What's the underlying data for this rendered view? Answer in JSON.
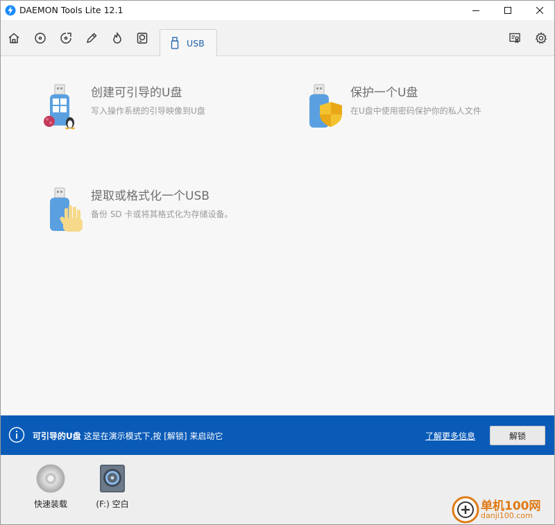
{
  "window": {
    "title": "DAEMON Tools Lite 12.1"
  },
  "toolbar": {
    "tabs": [
      {
        "icon": "home-icon"
      },
      {
        "icon": "disc-icon"
      },
      {
        "icon": "disc-image-icon"
      },
      {
        "icon": "pencil-icon"
      },
      {
        "icon": "flame-icon"
      },
      {
        "icon": "hdd-icon"
      }
    ],
    "active_tab_label": "USB",
    "right_icons": [
      "license-icon",
      "gear-icon"
    ]
  },
  "cards": [
    {
      "title": "创建可引导的U盘",
      "subtitle": "写入操作系统的引导映像到U盘"
    },
    {
      "title": "保护一个U盘",
      "subtitle": "在U盘中使用密码保护你的私人文件"
    },
    {
      "title": "提取或格式化一个USB",
      "subtitle": "备份 SD 卡或将其格式化为存储设备。"
    }
  ],
  "infobar": {
    "bold_text": "可引导的U盘",
    "text": " 这是在演示模式下,按 [解锁] 来启动它",
    "learn_more": "了解更多信息",
    "unlock_button": "解锁"
  },
  "devices": [
    {
      "label": "快速装载"
    },
    {
      "label": "(F:) 空白"
    }
  ],
  "watermark": {
    "name": "单机100网",
    "url": "danji100.com"
  },
  "colors": {
    "accent": "#0a5bb8",
    "tab_label": "#1b5fa8"
  }
}
